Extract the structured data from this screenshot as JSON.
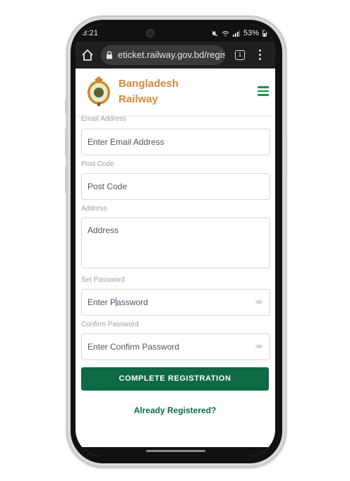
{
  "status": {
    "time": "3:21",
    "battery": "53%"
  },
  "browser": {
    "url": "eticket.railway.gov.bd/regis",
    "tab_count": "1"
  },
  "header": {
    "brand_line1": "Bangladesh",
    "brand_line2": "Railway"
  },
  "form": {
    "fields": [
      {
        "label": "Email Address",
        "placeholder": "Enter Email Address"
      },
      {
        "label": "Post Code",
        "placeholder": "Post Code"
      },
      {
        "label": "Address",
        "placeholder": "Address"
      },
      {
        "label": "Set Password",
        "placeholder_before_cursor": "Enter P",
        "placeholder_after_cursor": "assword"
      },
      {
        "label": "Confirm Password",
        "placeholder": "Enter Confirm Password"
      }
    ],
    "submit_label": "COMPLETE REGISTRATION",
    "already_registered": "Already Registered?"
  },
  "colors": {
    "brand_orange": "#d9873f",
    "primary_green": "#0e6a43",
    "menu_green": "#1d8f4e"
  },
  "icons": [
    "home-icon",
    "lock-icon",
    "menu-dots-icon",
    "hamburger-icon",
    "eye-icon",
    "railway-logo"
  ]
}
